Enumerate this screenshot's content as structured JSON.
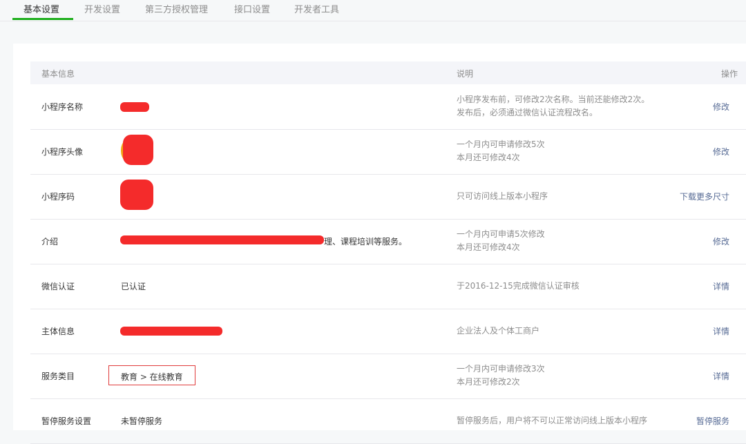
{
  "tabs": [
    {
      "label": "基本设置",
      "active": true
    },
    {
      "label": "开发设置",
      "active": false
    },
    {
      "label": "第三方授权管理",
      "active": false
    },
    {
      "label": "接口设置",
      "active": false
    },
    {
      "label": "开发者工具",
      "active": false
    }
  ],
  "table": {
    "headers": {
      "info": "基本信息",
      "desc": "说明",
      "action": "操作"
    },
    "rows": [
      {
        "label": "小程序名称",
        "value": "",
        "desc1": "小程序发布前，可修改2次名称。当前还能修改2次。",
        "desc2": "发布后，必须通过微信认证流程改名。",
        "action": "修改"
      },
      {
        "label": "小程序头像",
        "value": "",
        "desc1": "一个月内可申请修改5次",
        "desc2": "本月还可修改4次",
        "action": "修改"
      },
      {
        "label": "小程序码",
        "value": "",
        "desc1": "只可访问线上版本小程序",
        "desc2": "",
        "action": "下载更多尺寸"
      },
      {
        "label": "介绍",
        "value": "理、课程培训等服务。",
        "desc1": "一个月内可申请5次修改",
        "desc2": "本月还可修改4次",
        "action": "修改"
      },
      {
        "label": "微信认证",
        "value": "已认证",
        "desc1": "于2016-12-15完成微信认证审核",
        "desc2": "",
        "action": "详情"
      },
      {
        "label": "主体信息",
        "value": "",
        "desc1": "企业法人及个体工商户",
        "desc2": "",
        "action": "详情"
      },
      {
        "label": "服务类目",
        "value": "教育 > 在线教育",
        "desc1": "一个月内可申请修改3次",
        "desc2": "本月还可修改2次",
        "action": "详情"
      },
      {
        "label": "暂停服务设置",
        "value": "未暂停服务",
        "desc1": "暂停服务后，用户将不可以正常访问线上版本小程序",
        "desc2": "",
        "action": "暂停服务"
      }
    ]
  },
  "colors": {
    "accent": "#1aad19",
    "link": "#576b95",
    "highlight_border": "#e03a3a",
    "redaction": "#f42b2b"
  }
}
